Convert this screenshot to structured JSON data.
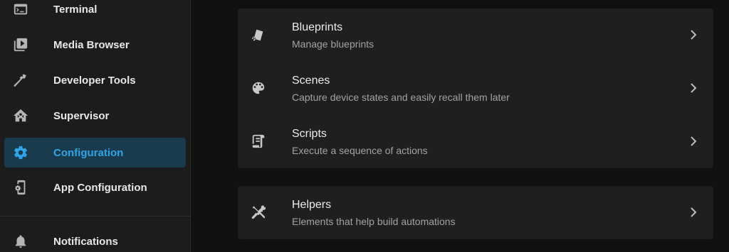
{
  "sidebar": {
    "items": [
      {
        "label": "Terminal",
        "icon": "terminal-icon"
      },
      {
        "label": "Media Browser",
        "icon": "media-browser-icon"
      },
      {
        "label": "Developer Tools",
        "icon": "hammer-icon"
      },
      {
        "label": "Supervisor",
        "icon": "supervisor-home-icon"
      },
      {
        "label": "Configuration",
        "icon": "gear-icon",
        "active": true
      },
      {
        "label": "App Configuration",
        "icon": "phone-settings-icon"
      },
      {
        "label": "Notifications",
        "icon": "bell-icon"
      }
    ]
  },
  "main": {
    "card1": [
      {
        "title": "Blueprints",
        "description": "Manage blueprints",
        "icon": "blueprint-icon"
      },
      {
        "title": "Scenes",
        "description": "Capture device states and easily recall them later",
        "icon": "palette-icon"
      },
      {
        "title": "Scripts",
        "description": "Execute a sequence of actions",
        "icon": "script-icon"
      }
    ],
    "card2": [
      {
        "title": "Helpers",
        "description": "Elements that help build automations",
        "icon": "tools-icon"
      }
    ]
  },
  "colors": {
    "accent": "#2fa5e8",
    "active_bg": "#1a3a4d",
    "sidebar_bg": "#1c1c1c",
    "card_bg": "#1f1f1f",
    "page_bg": "#111111"
  }
}
